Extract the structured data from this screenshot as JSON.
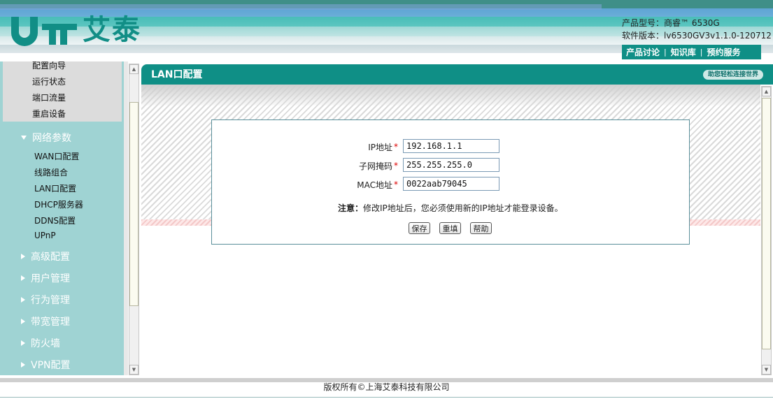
{
  "header": {
    "brand_text": "艾泰",
    "product_model_label": "产品型号：",
    "product_model_value": "商睿™ 6530G",
    "software_version_label": "软件版本：",
    "software_version_value": "lv6530GV3v1.1.0-120712",
    "links": [
      "产品讨论",
      "知识库",
      "预约服务"
    ]
  },
  "sidebar": {
    "top_items": [
      "配置向导",
      "运行状态",
      "端口流量",
      "重启设备"
    ],
    "groups": [
      {
        "label": "网络参数",
        "expanded": true,
        "items": [
          "WAN口配置",
          "线路组合",
          "LAN口配置",
          "DHCP服务器",
          "DDNS配置",
          "UPnP"
        ]
      },
      {
        "label": "高级配置",
        "expanded": false
      },
      {
        "label": "用户管理",
        "expanded": false
      },
      {
        "label": "行为管理",
        "expanded": false
      },
      {
        "label": "带宽管理",
        "expanded": false
      },
      {
        "label": "防火墙",
        "expanded": false
      },
      {
        "label": "VPN配置",
        "expanded": false
      }
    ]
  },
  "main": {
    "title": "LAN口配置",
    "slogan": "助您轻松连接世界",
    "form": {
      "ip_label": "IP地址",
      "ip_value": "192.168.1.1",
      "mask_label": "子网掩码",
      "mask_value": "255.255.255.0",
      "mac_label": "MAC地址",
      "mac_value": "0022aab79045",
      "required_mark": "*"
    },
    "note_label": "注意：",
    "note_text": "修改IP地址后，您必须使用新的IP地址才能登录设备。",
    "buttons": {
      "save": "保存",
      "reset": "重填",
      "help": "帮助"
    }
  },
  "footer": {
    "copyright": "版权所有©上海艾泰科技有限公司"
  },
  "colors": {
    "brand": "#0f8f86",
    "sidebar": "#9fd3d3",
    "required": "#dd0000"
  }
}
